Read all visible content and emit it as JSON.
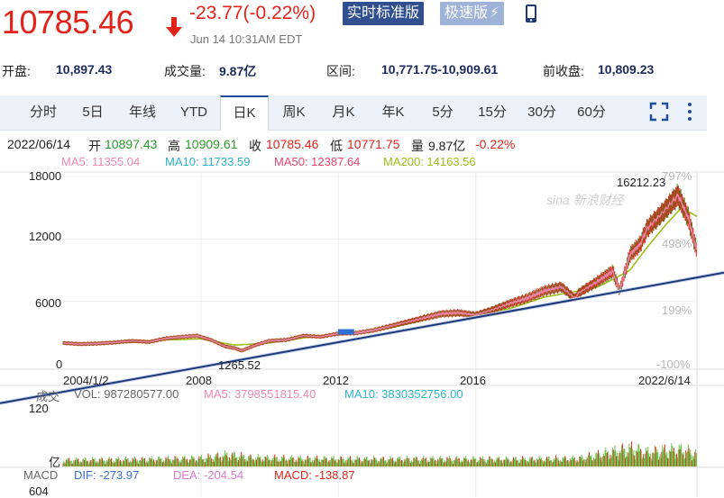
{
  "header": {
    "price": "10785.46",
    "change": "-23.77(-0.22%)",
    "timestamp": "Jun 14 10:31AM EDT",
    "btn_realtime": "实时标准版",
    "btn_fast": "极速版",
    "bolt": "⚡"
  },
  "stats": {
    "open_label": "开盘:",
    "open_value": "10,897.43",
    "volume_label": "成交量:",
    "volume_value": "9.87亿",
    "range_label": "区间:",
    "range_value": "10,771.75-10,909.61",
    "prev_label": "前收盘:",
    "prev_value": "10,809.23"
  },
  "tabs": [
    "分时",
    "5日",
    "年线",
    "YTD",
    "日K",
    "周K",
    "月K",
    "年K",
    "5分",
    "15分",
    "30分",
    "60分"
  ],
  "active_tab": "日K",
  "quote_line": {
    "date": "2022/06/14",
    "open_label": "开",
    "open": "10897.43",
    "high_label": "高",
    "high": "10909.61",
    "close_label": "收",
    "close": "10785.46",
    "low_label": "低",
    "low": "10771.75",
    "vol_label": "量",
    "vol": "9.87亿",
    "pct": "-0.22%"
  },
  "ma_line": {
    "ma5": "MA5: 11355.04",
    "ma10": "MA10: 11733.59",
    "ma50": "MA50: 12387.64",
    "ma200": "MA200: 14163.56"
  },
  "colors": {
    "up": "#e3231a",
    "down": "#2a9c2a",
    "ma5": "#f08ab0",
    "ma10": "#2bb4c8",
    "ma50": "#e8456a",
    "ma200": "#9bbf1a",
    "trend": "#1f3a7a",
    "volume": "#6cc04a"
  },
  "watermark": {
    "text": "sina 新浪财经"
  },
  "chart_data": [
    {
      "type": "line",
      "name": "daily-k",
      "x_labels": [
        "2004/1/2",
        "2008",
        "2012",
        "2016",
        "2022/6/14"
      ],
      "y_ticks": [
        "18000",
        "12000",
        "6000",
        "0"
      ],
      "y_right_ticks": [
        "797%",
        "498%",
        "199%",
        "-100%"
      ],
      "ylim": [
        0,
        18000
      ],
      "annotations": {
        "high": "16212.23",
        "low": "1265.52"
      },
      "series": [
        {
          "name": "price",
          "x": [
            2004,
            2004.5,
            2005,
            2005.5,
            2006,
            2006.5,
            2007,
            2007.5,
            2007.9,
            2008.3,
            2008.7,
            2009.0,
            2009.2,
            2009.6,
            2010,
            2010.5,
            2011,
            2011.5,
            2012,
            2012.5,
            2013,
            2013.5,
            2014,
            2014.5,
            2015,
            2015.5,
            2016,
            2016.5,
            2017,
            2017.5,
            2018,
            2018.5,
            2018.9,
            2019,
            2019.5,
            2020,
            2020.2,
            2020.5,
            2020.8,
            2021,
            2021.5,
            2021.9,
            2022.2,
            2022.45
          ],
          "y": [
            2000,
            1900,
            1950,
            2050,
            2200,
            2100,
            2450,
            2600,
            2700,
            2300,
            1700,
            1500,
            1265.52,
            1800,
            2200,
            2300,
            2700,
            2600,
            2900,
            2950,
            3200,
            3600,
            4000,
            4400,
            4800,
            4900,
            4700,
            5200,
            5800,
            6300,
            7000,
            7400,
            6300,
            6800,
            7800,
            8900,
            7000,
            10500,
            11500,
            13000,
            14700,
            16212.23,
            14000,
            10785.46
          ]
        },
        {
          "name": "MA200",
          "x": [
            2004,
            2005,
            2006,
            2007,
            2008,
            2009,
            2010,
            2011,
            2012,
            2013,
            2014,
            2015,
            2016,
            2017,
            2018,
            2019,
            2019.5,
            2020,
            2020.5,
            2021,
            2021.5,
            2022,
            2022.45
          ],
          "y": [
            1950,
            1950,
            2050,
            2300,
            2400,
            1800,
            2000,
            2500,
            2800,
            3100,
            3800,
            4600,
            4700,
            5300,
            6400,
            7000,
            7300,
            8100,
            9000,
            11200,
            13200,
            15000,
            14163.56
          ]
        }
      ],
      "trend_line": {
        "x": [
          2004,
          2022.45
        ],
        "y": [
          -500,
          8500
        ]
      }
    },
    {
      "type": "bar",
      "name": "volume",
      "label": "成交",
      "readout": {
        "vol": "VOL: 987280577.00",
        "ma5": "MA5: 3798551815.40",
        "ma10": "MA10: 3830352756.00"
      },
      "y_ticks": [
        "120",
        "亿"
      ],
      "ylim": [
        0,
        120
      ],
      "series": [
        {
          "name": "volume",
          "x": [
            2004,
            2006,
            2008,
            2008.8,
            2009.5,
            2011,
            2013,
            2015,
            2017,
            2019,
            2020.2,
            2020.6,
            2021.0,
            2021.5,
            2022,
            2022.45
          ],
          "y": [
            22,
            24,
            28,
            40,
            30,
            27,
            25,
            26,
            25,
            27,
            55,
            62,
            48,
            55,
            58,
            45
          ]
        }
      ]
    },
    {
      "type": "line",
      "name": "macd",
      "label": "MACD",
      "readout": {
        "dif": "DIF: -273.97",
        "dea": "DEA: -204.54",
        "macd": "MACD: -138.87"
      },
      "y_ticks": [
        "604"
      ]
    }
  ]
}
